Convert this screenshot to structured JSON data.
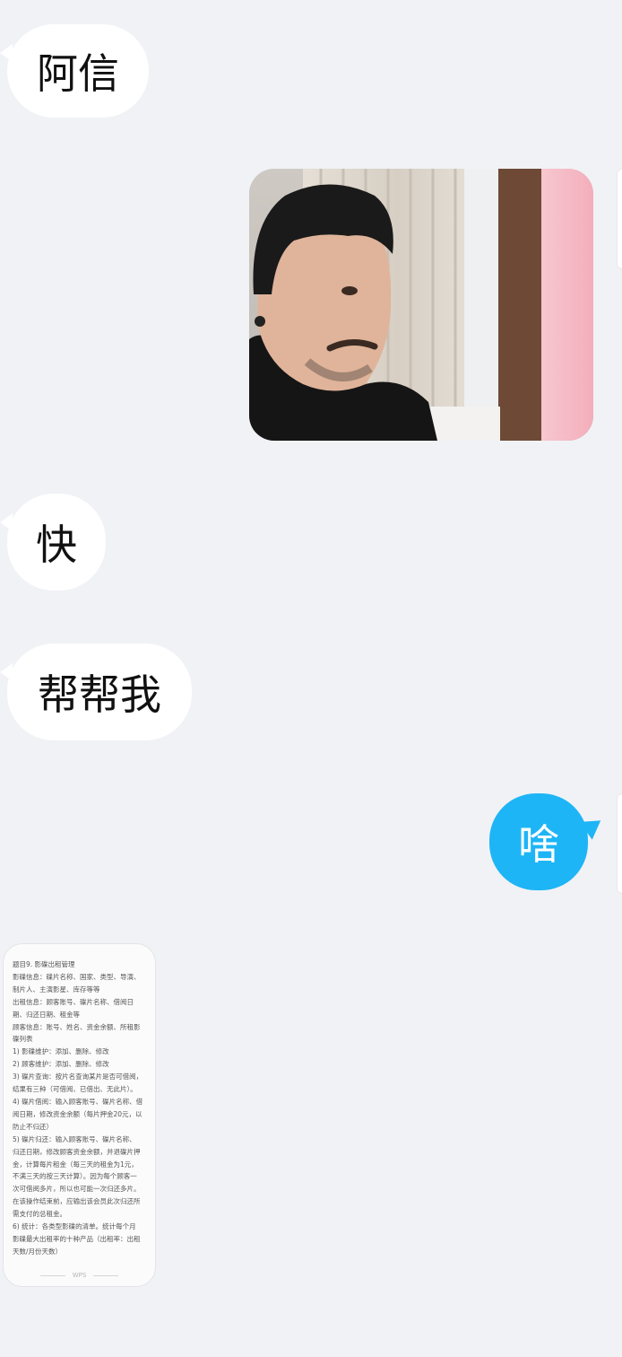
{
  "messages": [
    {
      "side": "left",
      "type": "text",
      "text": "阿信"
    },
    {
      "side": "right",
      "type": "image",
      "description": "photo"
    },
    {
      "side": "left",
      "type": "text",
      "text": "快"
    },
    {
      "side": "left",
      "type": "text",
      "text": "帮帮我"
    },
    {
      "side": "right",
      "type": "text",
      "text": "啥"
    },
    {
      "side": "left",
      "type": "document",
      "lines": [
        "题目9. 影碟出租管理",
        "影碟信息：碟片名称、国家、类型、导演、",
        "制片人、主演影星、库存等等",
        "出租信息：顾客账号、碟片名称、借阅日",
        "期、归还日期、租金等",
        "顾客信息：账号、姓名、资金余额、所租影",
        "碟列表",
        "  1) 影碟维护：添加、删除、修改",
        "  2) 顾客维护：添加、删除、修改",
        "3) 碟片查询：按片名查询某片是否可借阅，",
        "结果有三种（可借阅、已借出、无此片）。",
        "4) 碟片借阅：输入顾客账号、碟片名称、借",
        "阅日期，修改资金余额（每片押金20元，以",
        "防止不归还）",
        "5) 碟片归还：输入顾客账号、碟片名称、",
        "归还日期，修改顾客资金余额，并退碟片押",
        "金，计算每片租金（每三天的租金为1元，",
        "不满三天的按三天计算）。因为每个顾客一",
        "次可借阅多片，所以也可能一次归还多片。",
        "在该操作结束前，应输出该会员此次归还所",
        "需支付的总租金。",
        "  6) 统计：各类型影碟的清单。统计每个月",
        "影碟最大出租率的十种产品（出租率：出租",
        "天数/月份天数）"
      ],
      "footer": "WPS"
    }
  ],
  "colors": {
    "background": "#f1f2f6",
    "incoming_bubble": "#ffffff",
    "outgoing_bubble": "#1eb5f6"
  }
}
